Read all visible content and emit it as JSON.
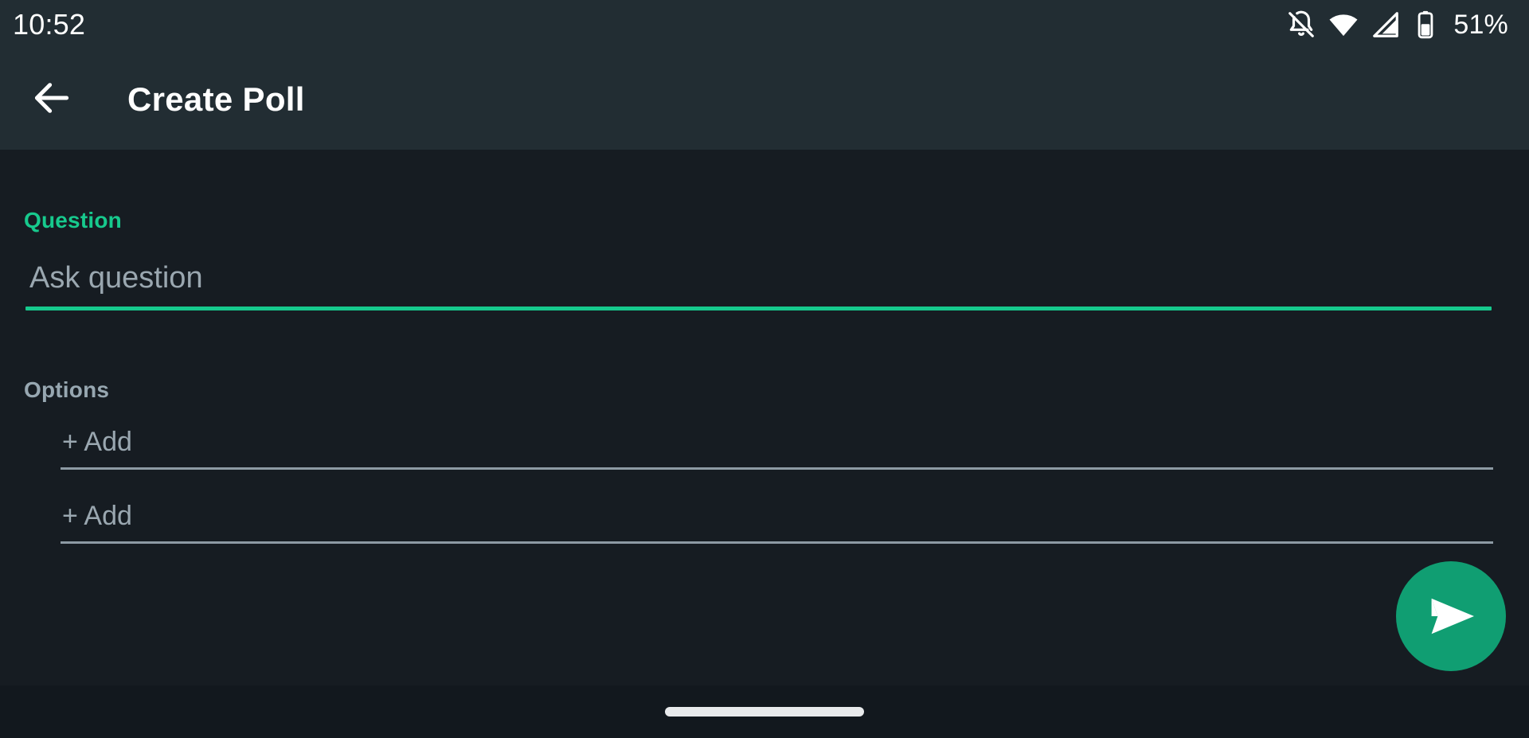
{
  "status_bar": {
    "time": "10:52",
    "battery_percent": "51%",
    "icons": [
      {
        "name": "notifications-off-icon",
        "label": "Silent"
      },
      {
        "name": "wifi-icon",
        "label": "Wi-Fi"
      },
      {
        "name": "cellular-signal-icon",
        "label": "Mobile signal"
      },
      {
        "name": "battery-icon",
        "label": "Battery"
      }
    ]
  },
  "app_bar": {
    "back_label": "Back",
    "title": "Create Poll"
  },
  "form": {
    "question": {
      "label": "Question",
      "value": "",
      "placeholder": "Ask question"
    },
    "options": {
      "label": "Options",
      "items": [
        {
          "value": "",
          "placeholder": "+ Add"
        },
        {
          "value": "",
          "placeholder": "+ Add"
        }
      ]
    }
  },
  "fab": {
    "name": "send-button",
    "label": "Send"
  },
  "nav_bar": {
    "pill_label": "Home gesture bar"
  },
  "colors": {
    "accent": "#16c98d",
    "accent_fab": "#109e72",
    "app_bar_bg": "#222d33",
    "body_bg": "#161c22",
    "nav_bg": "#12181e",
    "placeholder": "#9aa7b0",
    "label_muted": "#97a7b1",
    "underline_muted": "#8d9aa4"
  }
}
